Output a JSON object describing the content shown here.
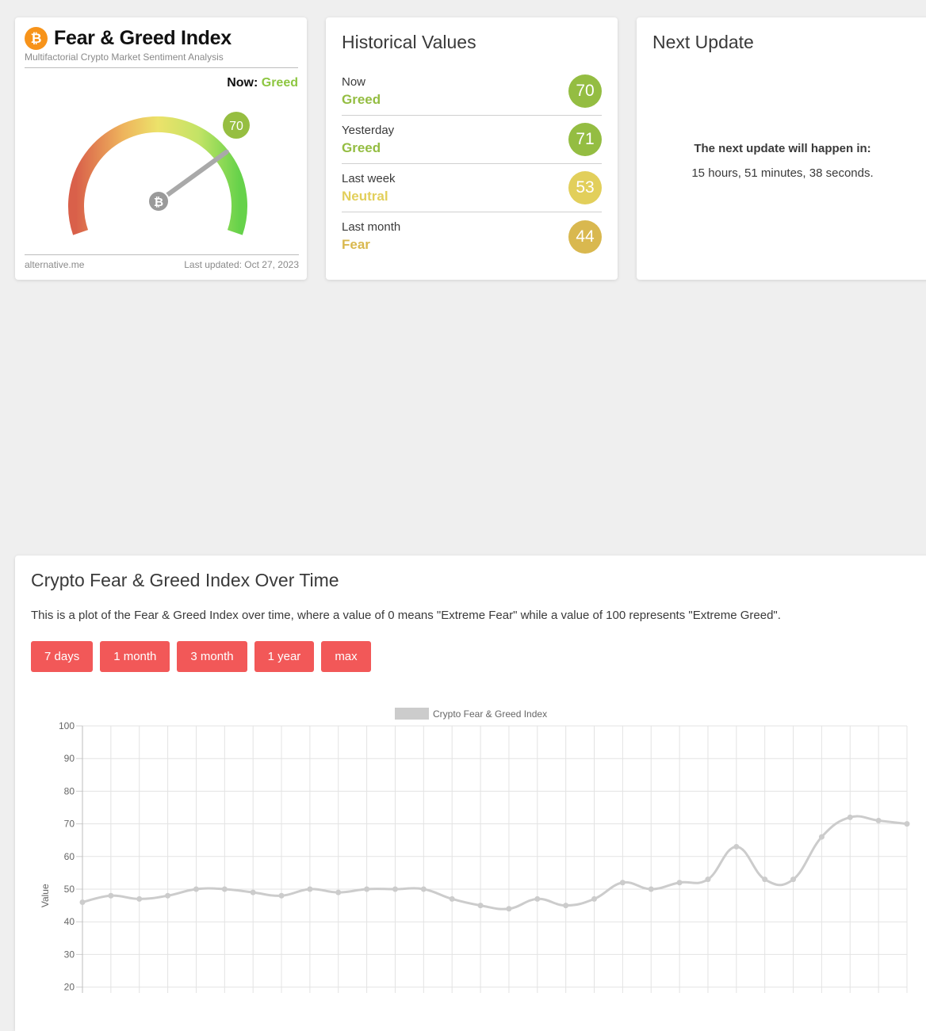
{
  "fear_greed_card": {
    "icon": "bitcoin-icon",
    "title": "Fear & Greed Index",
    "subtitle": "Multifactorial Crypto Market Sentiment Analysis",
    "now_prefix": "Now:",
    "now_class": "Greed",
    "value": "70",
    "gauge_level": 70,
    "footer_left": "alternative.me",
    "footer_right": "Last updated: Oct 27, 2023",
    "colors": {
      "greed": "#8dc641",
      "badge": "#96be41"
    }
  },
  "historical": {
    "title": "Historical Values",
    "rows": [
      {
        "label": "Now",
        "class": "Greed",
        "value": "70",
        "color": "#94bd42"
      },
      {
        "label": "Yesterday",
        "class": "Greed",
        "value": "71",
        "color": "#94bd42"
      },
      {
        "label": "Last week",
        "class": "Neutral",
        "value": "53",
        "color": "#e2cf5b"
      },
      {
        "label": "Last month",
        "class": "Fear",
        "value": "44",
        "color": "#d9b84f"
      }
    ]
  },
  "next_update": {
    "title": "Next Update",
    "heading": "The next update will happen in:",
    "countdown": "15 hours, 51 minutes, 38 seconds."
  },
  "chart_section": {
    "title": "Crypto Fear & Greed Index Over Time",
    "description": "This is a plot of the Fear & Greed Index over time, where a value of 0 means \"Extreme Fear\" while a value of 100 represents \"Extreme Greed\".",
    "buttons": [
      "7 days",
      "1 month",
      "3 month",
      "1 year",
      "max"
    ],
    "button_color": "#f25858"
  },
  "chart_data": {
    "type": "line",
    "legend": "Crypto Fear & Greed Index",
    "legend_position": "top",
    "ylabel": "Value",
    "xlabel": "",
    "ylim": [
      20,
      100
    ],
    "yticks": [
      20,
      30,
      40,
      50,
      60,
      70,
      80,
      90,
      100
    ],
    "grid": true,
    "line_color": "#cccccc",
    "series": [
      {
        "name": "Crypto Fear & Greed Index",
        "values": [
          46,
          48,
          47,
          48,
          50,
          50,
          49,
          48,
          50,
          49,
          50,
          50,
          50,
          47,
          45,
          44,
          47,
          45,
          47,
          52,
          50,
          52,
          53,
          63,
          53,
          53,
          66,
          72,
          71,
          70
        ]
      }
    ]
  }
}
